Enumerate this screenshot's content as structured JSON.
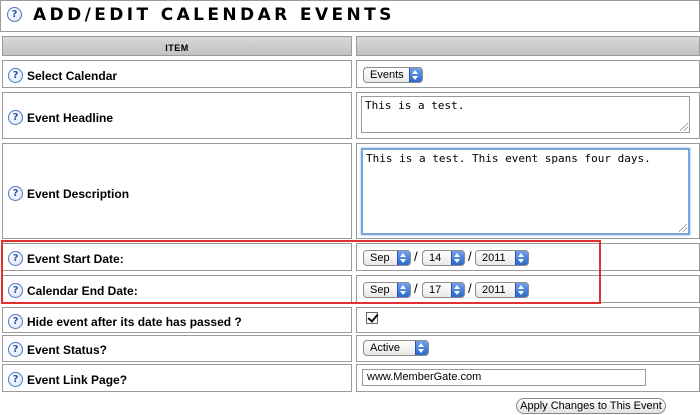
{
  "header": {
    "title": "ADD/EDIT CALENDAR EVENTS",
    "help_glyph": "?"
  },
  "table": {
    "column_header": "ITEM",
    "rows": {
      "select_calendar": {
        "label": "Select Calendar",
        "value": "Events"
      },
      "event_headline": {
        "label": "Event Headline",
        "value": "This is a test."
      },
      "event_description": {
        "label": "Event Description",
        "value": "This is a test. This event spans four days."
      },
      "event_start_date": {
        "label": "Event Start Date:",
        "month": "Sep",
        "day": "14",
        "year": "2011"
      },
      "calendar_end_date": {
        "label": "Calendar End Date:",
        "month": "Sep",
        "day": "17",
        "year": "2011"
      },
      "hide_event": {
        "label": "Hide event after its date has passed ?",
        "checked": true
      },
      "event_status": {
        "label": "Event Status?",
        "value": "Active"
      },
      "event_link_page": {
        "label": "Event Link Page?",
        "value": "www.MemberGate.com"
      }
    },
    "date_separator": "/"
  },
  "actions": {
    "apply_label": "Apply Changes to This Event"
  },
  "colors": {
    "highlight": "#e23030",
    "select_arrow": "#2c66cf",
    "focus_ring": "#7aa6e0"
  },
  "icons": {
    "help": "help-question-icon",
    "checkbox": "checkmark-icon",
    "select": "updown-arrows-icon"
  }
}
